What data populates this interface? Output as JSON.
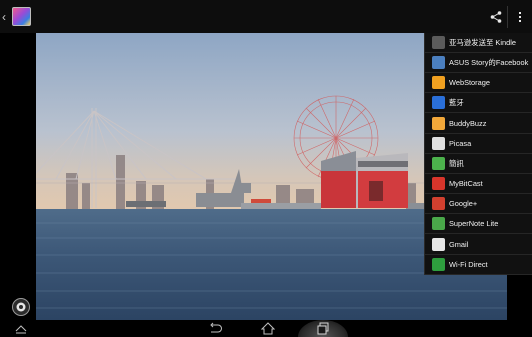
{
  "colors": {
    "topbar": "#0d0d0d",
    "menu_bg": "#111111",
    "menu_text": "#f2f2f2"
  },
  "topbar": {
    "back_icon": "chevron-left-icon",
    "app_icon": "gallery-icon",
    "share_icon": "share-icon",
    "overflow_icon": "overflow-menu-icon"
  },
  "share_menu": {
    "items": [
      {
        "label": "亚马逊发送至 Kindle",
        "icon": "kindle-icon",
        "color": "#5b5b5b"
      },
      {
        "label": "ASUS Story的Facebook",
        "icon": "asus-story-icon",
        "color": "#4b7fbf"
      },
      {
        "label": "WebStorage",
        "icon": "webstorage-icon",
        "color": "#f0a020"
      },
      {
        "label": "藍牙",
        "icon": "bluetooth-icon",
        "color": "#2a6fd8"
      },
      {
        "label": "BuddyBuzz",
        "icon": "buddybuzz-icon",
        "color": "#f2a83a"
      },
      {
        "label": "Picasa",
        "icon": "picasa-icon",
        "color": "#e0e0e0"
      },
      {
        "label": "簡訊",
        "icon": "messaging-icon",
        "color": "#4cb24c"
      },
      {
        "label": "MyBitCast",
        "icon": "mybitcast-icon",
        "color": "#d8352b"
      },
      {
        "label": "Google+",
        "icon": "google-plus-icon",
        "color": "#d2402f"
      },
      {
        "label": "SuperNote Lite",
        "icon": "supernote-icon",
        "color": "#4aa84a"
      },
      {
        "label": "Gmail",
        "icon": "gmail-icon",
        "color": "#e6e6e6"
      },
      {
        "label": "Wi-Fi Direct",
        "icon": "wifi-direct-icon",
        "color": "#2e9e3e"
      }
    ]
  },
  "navbar": {
    "hide_icon": "hide-nav-icon",
    "back_icon": "back-icon",
    "home_icon": "home-icon",
    "recent_icon": "recent-apps-icon"
  },
  "photo": {
    "subject": "harbor-photo"
  }
}
